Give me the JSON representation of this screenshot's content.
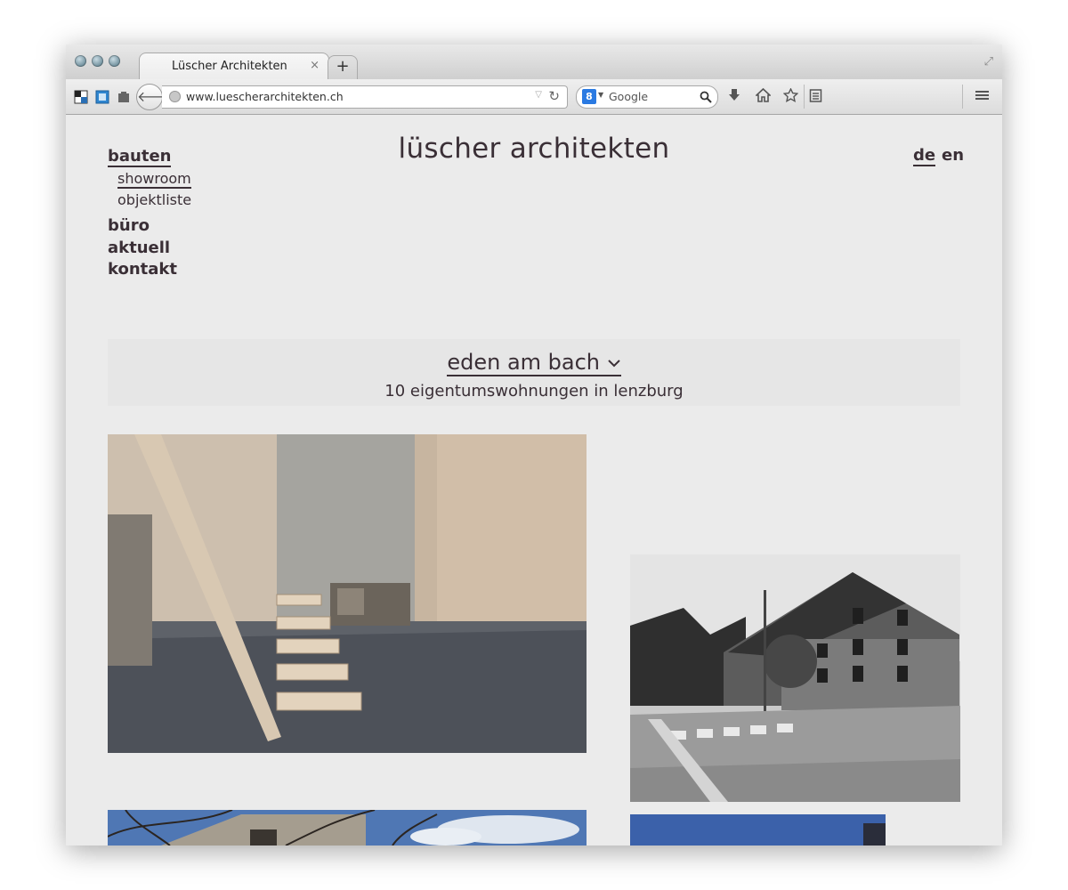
{
  "browser": {
    "tab_title": "Lüscher Architekten",
    "tab_close": "×",
    "new_tab": "+",
    "url": "www.luescherarchitekten.ch",
    "search_placeholder": "Google",
    "search_engine_badge": "8"
  },
  "site": {
    "title": "lüscher architekten",
    "menu": {
      "bauten": "bauten",
      "showroom": "showroom",
      "objektliste": "objektliste",
      "buero": "büro",
      "aktuell": "aktuell",
      "kontakt": "kontakt"
    },
    "languages": {
      "de": "de",
      "en": "en"
    },
    "project": {
      "title": "eden am bach",
      "subtitle": "10 eigentumswohnungen in lenzburg"
    }
  },
  "icons": [
    "back-arrow-icon",
    "globe-icon",
    "reload-icon",
    "search-icon",
    "download-icon",
    "home-icon",
    "bookmark-star-icon",
    "reading-list-icon",
    "menu-icon",
    "fullscreen-icon"
  ]
}
